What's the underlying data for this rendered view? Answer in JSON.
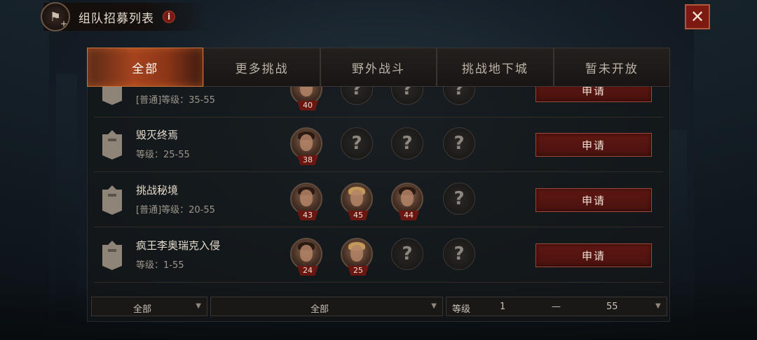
{
  "header": {
    "title": "组队招募列表",
    "info": "i",
    "close": "✕"
  },
  "tabs": [
    {
      "label": "全部",
      "active": true
    },
    {
      "label": "更多挑战",
      "active": false
    },
    {
      "label": "野外战斗",
      "active": false
    },
    {
      "label": "挑战地下城",
      "active": false
    },
    {
      "label": "暂未开放",
      "active": false
    }
  ],
  "rows": [
    {
      "name": "",
      "level": "[普通]等级：35-55",
      "members": [
        "40",
        "?",
        "?",
        "?"
      ],
      "apply": "申请"
    },
    {
      "name": "毁灭终焉",
      "level": "等级：25-55",
      "members": [
        "38",
        "?",
        "?",
        "?"
      ],
      "apply": "申请"
    },
    {
      "name": "挑战秘境",
      "level": "[普通]等级：20-55",
      "members": [
        "43",
        "45",
        "44",
        "?"
      ],
      "apply": "申请"
    },
    {
      "name": "疯王李奥瑞克入侵",
      "level": "等级：1-55",
      "members": [
        "24",
        "25",
        "?",
        "?"
      ],
      "apply": "申请"
    }
  ],
  "filters": {
    "type": "全部",
    "category": "全部",
    "level_label": "等级",
    "level_min": "1",
    "level_sep": "—",
    "level_max": "55",
    "arrow": "▼"
  },
  "colors": {
    "accent": "#7c1911",
    "tab_active": "#a5431e"
  }
}
